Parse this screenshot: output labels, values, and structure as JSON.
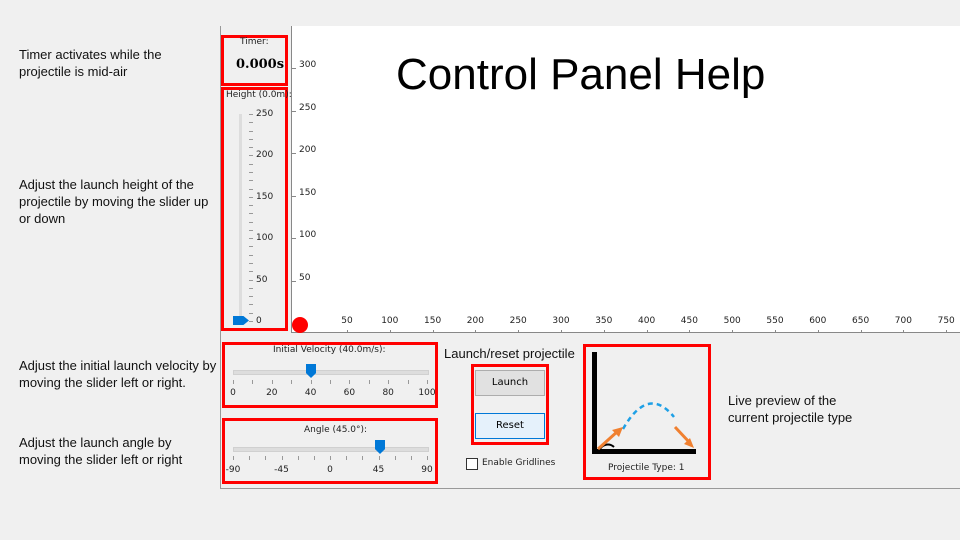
{
  "title": "Control Panel Help",
  "help": {
    "timer": "Timer activates while the projectile is mid-air",
    "height": "Adjust the launch height of the projectile by moving the slider up or down",
    "velocity": "Adjust the initial launch velocity by moving the slider left or right.",
    "angle": "Adjust the launch angle by moving the slider left or right",
    "launch": "Launch/reset projectile",
    "preview": "Live preview of the current projectile type"
  },
  "timer": {
    "label": "Timer:",
    "value": "0.000s"
  },
  "height_slider": {
    "label": "Height (0.0m):",
    "ticks": [
      "250",
      "200",
      "150",
      "100",
      "50",
      "0"
    ],
    "value": 0,
    "min": 0,
    "max": 250
  },
  "velocity_slider": {
    "label": "Initial Velocity (40.0m/s):",
    "ticks": [
      "0",
      "20",
      "40",
      "60",
      "80",
      "100"
    ],
    "value": 40,
    "min": 0,
    "max": 100
  },
  "angle_slider": {
    "label": "Angle (45.0°):",
    "ticks": [
      "-90",
      "-45",
      "0",
      "45",
      "90"
    ],
    "value": 45,
    "min": -90,
    "max": 90
  },
  "buttons": {
    "launch": "Launch",
    "reset": "Reset"
  },
  "gridlines": {
    "label": "Enable Gridlines",
    "checked": false
  },
  "preview": {
    "label": "Projectile Type: 1"
  },
  "plot": {
    "x_ticks": [
      "50",
      "100",
      "150",
      "200",
      "250",
      "300",
      "350",
      "400",
      "450",
      "500",
      "550",
      "600",
      "650",
      "700",
      "750"
    ],
    "y_ticks": [
      "300",
      "250",
      "200",
      "150",
      "100",
      "50"
    ]
  },
  "colors": {
    "highlight": "#ff0000",
    "thumb": "#0078d7",
    "arrow": "#f08030",
    "path": "#1ea0e6",
    "ball": "#ff0000"
  }
}
